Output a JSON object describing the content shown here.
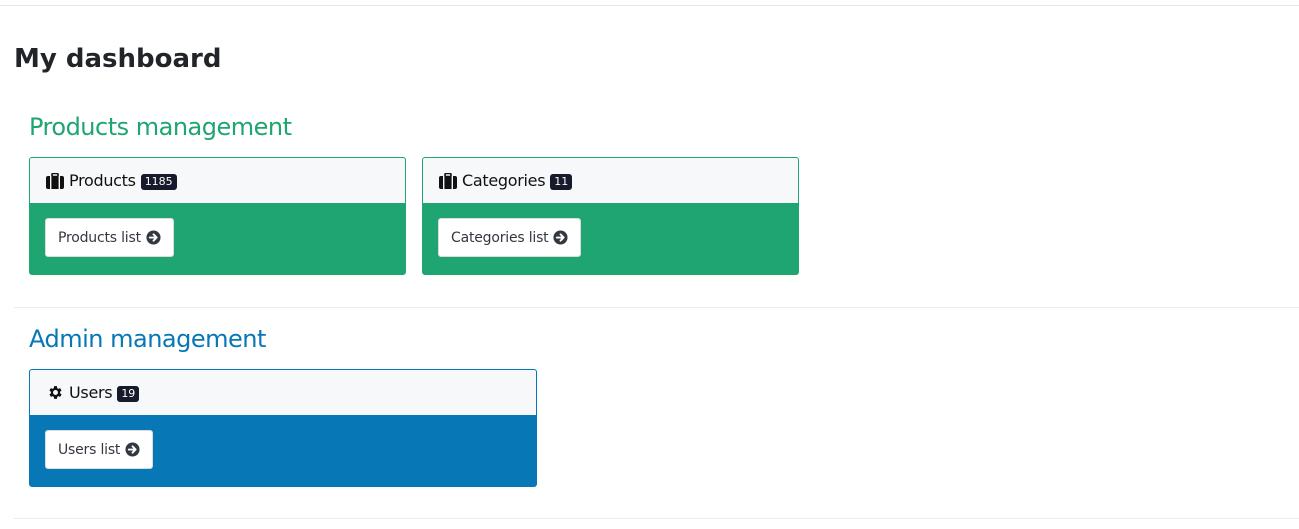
{
  "page": {
    "title": "My dashboard"
  },
  "sections": [
    {
      "title": "Products management",
      "color": "#1fa571",
      "cards": [
        {
          "icon": "briefcase-icon",
          "title": "Products",
          "count": "1185",
          "button_label": "Products list"
        },
        {
          "icon": "briefcase-icon",
          "title": "Categories",
          "count": "11",
          "button_label": "Categories list"
        }
      ]
    },
    {
      "title": "Admin management",
      "color": "#0877b6",
      "cards": [
        {
          "icon": "gear-icon",
          "title": "Users",
          "count": "19",
          "button_label": "Users list"
        }
      ]
    }
  ],
  "colors": {
    "header_bg": "#f7f8fa",
    "badge_bg": "#161a2a",
    "text": "#212529"
  }
}
